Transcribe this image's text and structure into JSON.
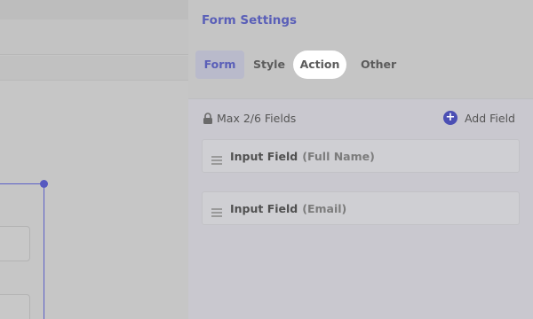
{
  "panel": {
    "title": "Form Settings",
    "tabs": [
      {
        "label": "Form",
        "active": true
      },
      {
        "label": "Style"
      },
      {
        "label": "Action",
        "highlighted": true
      },
      {
        "label": "Other"
      }
    ],
    "limit_text": "Max 2/6 Fields",
    "add_field_label": "Add Field",
    "fields": [
      {
        "type": "Input Field",
        "name": "(Full Name)"
      },
      {
        "type": "Input Field",
        "name": "(Email)"
      }
    ]
  },
  "icons": {
    "lock": "lock-icon",
    "add": "plus-circle-icon",
    "drag": "drag-handle-icon"
  },
  "colors": {
    "accent": "#5a5fb8",
    "highlight": "#ffffff"
  }
}
